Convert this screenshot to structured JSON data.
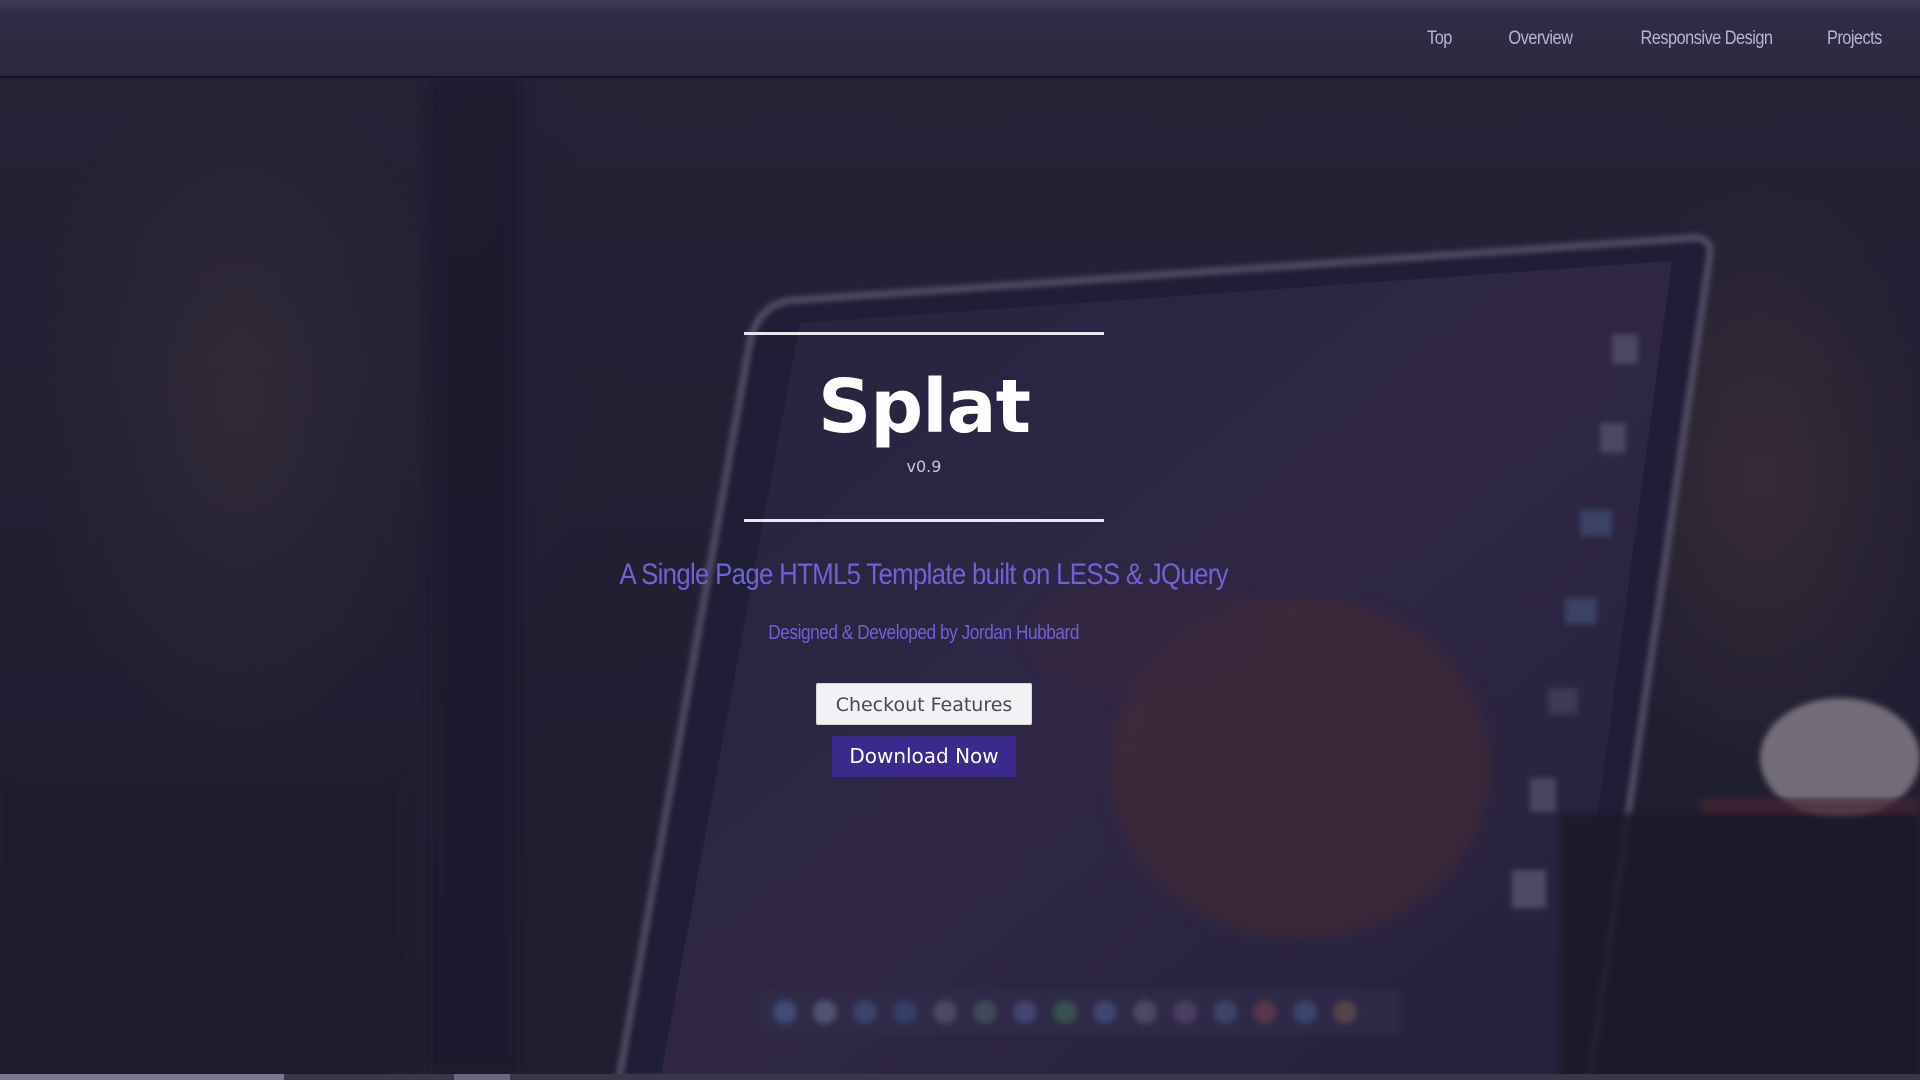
{
  "nav": {
    "items": [
      {
        "label": "Top"
      },
      {
        "label": "Overview"
      },
      {
        "label": "Responsive Design"
      },
      {
        "label": "Projects"
      }
    ]
  },
  "hero": {
    "title": "Splat",
    "version": "v0.9",
    "tagline": "A Single Page HTML5 Template built on LESS & JQuery",
    "credit": "Designed & Developed by Jordan Hubbard",
    "primary_button": "Checkout Features",
    "download_button": "Download Now"
  },
  "colors": {
    "accent": "#6f62d4",
    "button_primary": "#3b2a8c",
    "navbar": "#2b293f"
  }
}
